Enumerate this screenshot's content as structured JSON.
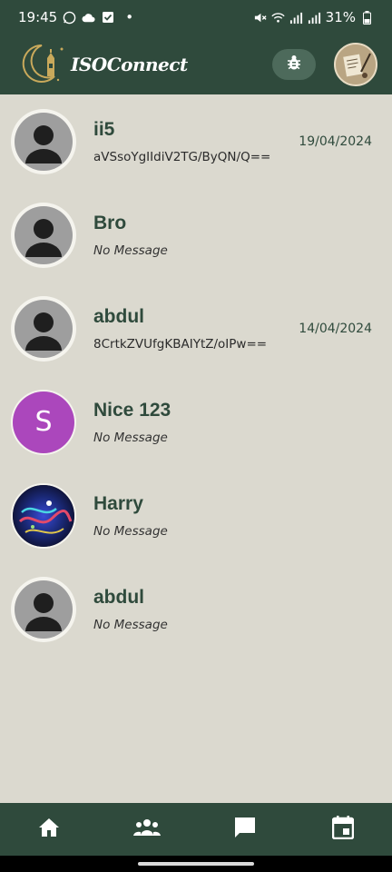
{
  "status_bar": {
    "time": "19:45",
    "battery": "31%",
    "dot": "•"
  },
  "app_bar": {
    "logo_text": "ISOConnect",
    "bug_icon": "bug-icon",
    "profile_icon": "profile-avatar"
  },
  "chats": [
    {
      "name": "ii5",
      "message": "aVSsoYgIIdiV2TG/ByQN/Q==",
      "date": "19/04/2024",
      "avatar": "default"
    },
    {
      "name": "Bro",
      "message": "No Message",
      "date": "",
      "avatar": "default"
    },
    {
      "name": "abdul",
      "message": "8CrtkZVUfgKBAIYtZ/oIPw==",
      "date": "14/04/2024",
      "avatar": "default"
    },
    {
      "name": "Nice 123",
      "message": "No Message",
      "date": "",
      "avatar": "letter",
      "avatar_letter": "S"
    },
    {
      "name": "Harry",
      "message": "No Message",
      "date": "",
      "avatar": "photo"
    },
    {
      "name": "abdul",
      "message": "No Message",
      "date": "",
      "avatar": "default"
    }
  ],
  "bottom_nav": {
    "items": [
      "home-icon",
      "groups-icon",
      "chat-icon",
      "calendar-icon"
    ]
  },
  "colors": {
    "primary": "#2f4a3c",
    "background": "#dbd9cf",
    "letter_avatar": "#ab47bc"
  }
}
